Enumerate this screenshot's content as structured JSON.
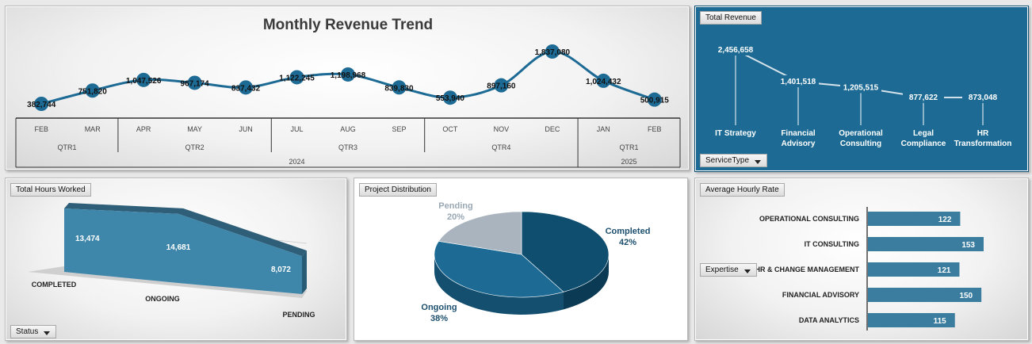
{
  "colors": {
    "accent": "#1d6b94",
    "accent_dark": "#0f4e6f",
    "bar": "#3a7d9f",
    "pending_gray": "#a9b4be"
  },
  "trend": {
    "title": "Monthly Revenue Trend",
    "months": [
      "FEB",
      "MAR",
      "APR",
      "MAY",
      "JUN",
      "JUL",
      "AUG",
      "SEP",
      "OCT",
      "NOV",
      "DEC",
      "JAN",
      "FEB"
    ],
    "values": [
      382744,
      751820,
      1047526,
      967174,
      837432,
      1122245,
      1198968,
      839830,
      553940,
      897160,
      1837080,
      1024432,
      500915
    ],
    "value_labels": [
      "382,744",
      "751,820",
      "1,047,526",
      "967,174",
      "837,432",
      "1,122,245",
      "1,198,968",
      "839,830",
      "553,940",
      "897,160",
      "1,837,080",
      "1,024,432",
      "500,915"
    ],
    "quarters": [
      "QTR1",
      "QTR2",
      "QTR3",
      "QTR4",
      "QTR1"
    ],
    "years": [
      "2024",
      "2025"
    ]
  },
  "total_revenue": {
    "tag": "Total Revenue",
    "filter": "ServiceType",
    "categories": [
      "IT Strategy",
      "Financial Advisory",
      "Operational Consulting",
      "Legal Compliance",
      "HR Transformation"
    ],
    "category_lines": [
      [
        "IT Strategy"
      ],
      [
        "Financial",
        "Advisory"
      ],
      [
        "Operational",
        "Consulting"
      ],
      [
        "Legal",
        "Compliance"
      ],
      [
        "HR",
        "Transformation"
      ]
    ],
    "values": [
      2456658,
      1401518,
      1205515,
      877622,
      873048
    ],
    "value_labels": [
      "2,456,658",
      "1,401,518",
      "1,205,515",
      "877,622",
      "873,048"
    ]
  },
  "hours": {
    "tag": "Total Hours Worked",
    "filter": "Status",
    "categories": [
      "COMPLETED",
      "ONGOING",
      "PENDING"
    ],
    "values": [
      13474,
      14681,
      8072
    ],
    "value_labels": [
      "13,474",
      "14,681",
      "8,072"
    ]
  },
  "distribution": {
    "tag": "Project Distribution",
    "slices": [
      {
        "name": "Completed",
        "pct": 42,
        "pct_label": "42%"
      },
      {
        "name": "Ongoing",
        "pct": 38,
        "pct_label": "38%"
      },
      {
        "name": "Pending",
        "pct": 20,
        "pct_label": "20%"
      }
    ]
  },
  "hourly_rate": {
    "tag": "Average Hourly Rate",
    "filter": "Expertise",
    "categories": [
      "OPERATIONAL CONSULTING",
      "IT CONSULTING",
      "HR & CHANGE MANAGEMENT",
      "FINANCIAL ADVISORY",
      "DATA ANALYTICS"
    ],
    "values": [
      122,
      153,
      121,
      150,
      115
    ],
    "value_labels": [
      "122",
      "153",
      "121",
      "150",
      "115"
    ]
  },
  "chart_data": [
    {
      "type": "line",
      "title": "Monthly Revenue Trend",
      "x": [
        "FEB",
        "MAR",
        "APR",
        "MAY",
        "JUN",
        "JUL",
        "AUG",
        "SEP",
        "OCT",
        "NOV",
        "DEC",
        "JAN",
        "FEB"
      ],
      "y": [
        382744,
        751820,
        1047526,
        967174,
        837432,
        1122245,
        1198968,
        839830,
        553940,
        897160,
        1837080,
        1024432,
        500915
      ]
    },
    {
      "type": "line",
      "categories": [
        "IT Strategy",
        "Financial Advisory",
        "Operational Consulting",
        "Legal Compliance",
        "HR Transformation"
      ],
      "values": [
        2456658,
        1401518,
        1205515,
        877622,
        873048
      ]
    },
    {
      "type": "area",
      "categories": [
        "COMPLETED",
        "ONGOING",
        "PENDING"
      ],
      "values": [
        13474,
        14681,
        8072
      ]
    },
    {
      "type": "pie",
      "categories": [
        "Completed",
        "Ongoing",
        "Pending"
      ],
      "values": [
        42,
        38,
        20
      ]
    },
    {
      "type": "bar",
      "categories": [
        "OPERATIONAL CONSULTING",
        "IT CONSULTING",
        "HR & CHANGE MANAGEMENT",
        "FINANCIAL ADVISORY",
        "DATA ANALYTICS"
      ],
      "values": [
        122,
        153,
        121,
        150,
        115
      ]
    }
  ]
}
